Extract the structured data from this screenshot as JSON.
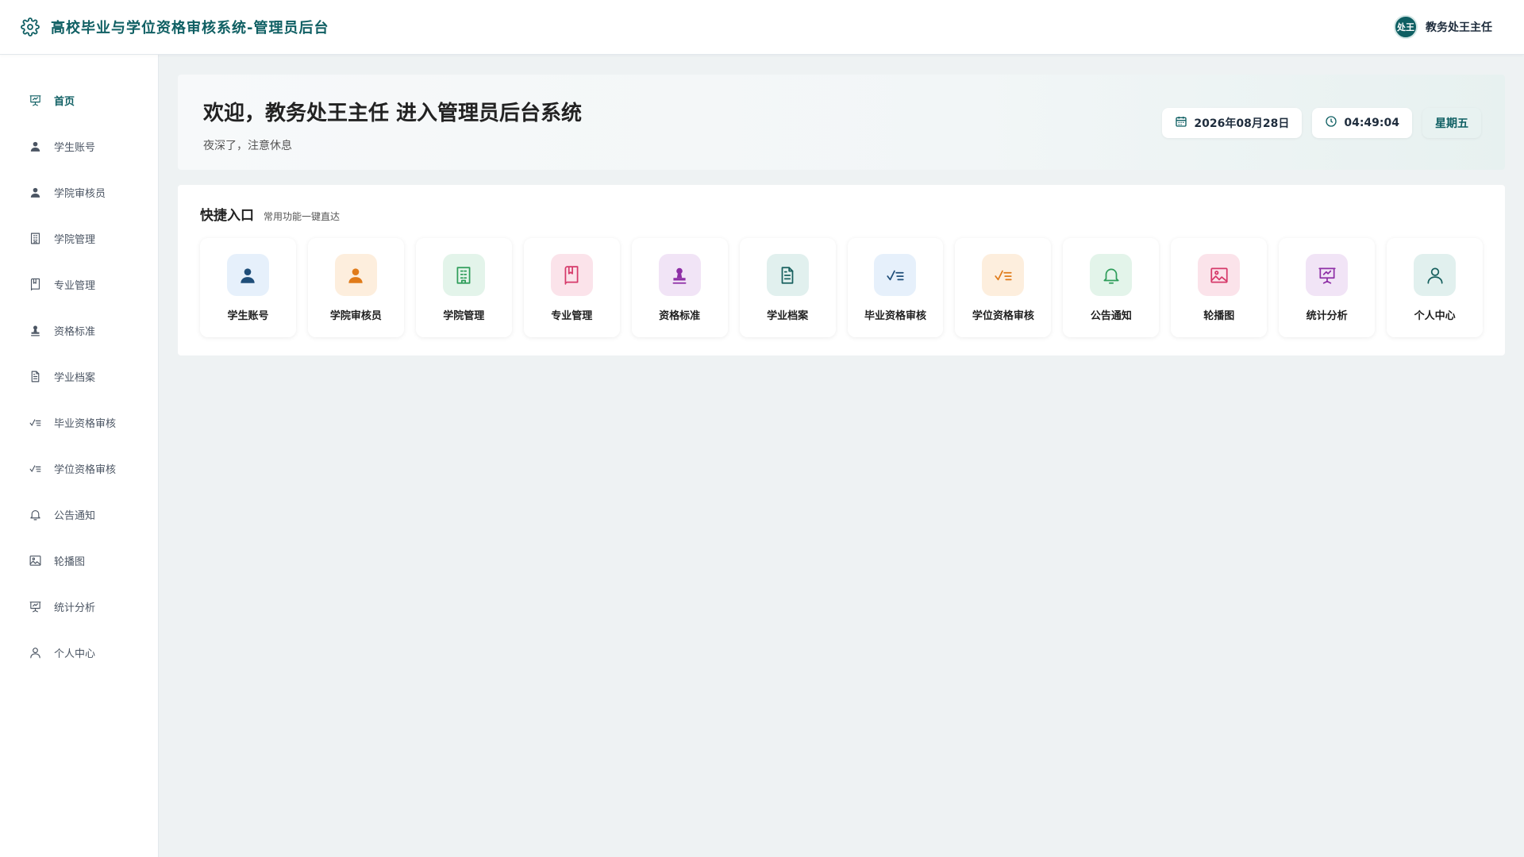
{
  "header": {
    "title": "高校毕业与学位资格审核系统-管理员后台",
    "user_avatar_text": "处王",
    "user_name": "教务处王主任",
    "accent": "#0f5f63"
  },
  "sidebar": {
    "items": [
      {
        "label": "首页",
        "icon": "dashboard-icon",
        "active": true
      },
      {
        "label": "学生账号",
        "icon": "user-icon"
      },
      {
        "label": "学院审核员",
        "icon": "user-icon"
      },
      {
        "label": "学院管理",
        "icon": "building-icon"
      },
      {
        "label": "专业管理",
        "icon": "book-icon"
      },
      {
        "label": "资格标准",
        "icon": "stamp-icon"
      },
      {
        "label": "学业档案",
        "icon": "document-icon"
      },
      {
        "label": "毕业资格审核",
        "icon": "check-list-icon"
      },
      {
        "label": "学位资格审核",
        "icon": "check-list-icon"
      },
      {
        "label": "公告通知",
        "icon": "bell-icon"
      },
      {
        "label": "轮播图",
        "icon": "image-icon"
      },
      {
        "label": "统计分析",
        "icon": "presentation-icon"
      },
      {
        "label": "个人中心",
        "icon": "profile-icon"
      }
    ]
  },
  "welcome": {
    "title": "欢迎，教务处王主任 进入管理员后台系统",
    "subtitle": "夜深了，注意休息",
    "date": "2026年08月28日",
    "time": "04:49:04",
    "weekday": "星期五"
  },
  "quick": {
    "title": "快捷入口",
    "subtitle": "常用功能一键直达",
    "tiles": [
      {
        "label": "学生账号",
        "icon": "user-icon",
        "bg": "#e6f0fb",
        "fg": "#1f4e79"
      },
      {
        "label": "学院审核员",
        "icon": "user-icon",
        "bg": "#fdeedd",
        "fg": "#e07b1a"
      },
      {
        "label": "学院管理",
        "icon": "building-icon",
        "bg": "#e3f4ea",
        "fg": "#2e9d5a"
      },
      {
        "label": "专业管理",
        "icon": "book-icon",
        "bg": "#fbe3ea",
        "fg": "#d63a6a"
      },
      {
        "label": "资格标准",
        "icon": "stamp-icon",
        "bg": "#f1e4f6",
        "fg": "#8e2fa6"
      },
      {
        "label": "学业档案",
        "icon": "document-icon",
        "bg": "#e1f0ee",
        "fg": "#17605e"
      },
      {
        "label": "毕业资格审核",
        "icon": "check-list-icon",
        "bg": "#e6f0fb",
        "fg": "#1f4e79"
      },
      {
        "label": "学位资格审核",
        "icon": "check-list-icon",
        "bg": "#fdeedd",
        "fg": "#e07b1a"
      },
      {
        "label": "公告通知",
        "icon": "bell-icon",
        "bg": "#e3f4ea",
        "fg": "#2e9d5a"
      },
      {
        "label": "轮播图",
        "icon": "image-icon",
        "bg": "#fbe3ea",
        "fg": "#d63a6a"
      },
      {
        "label": "统计分析",
        "icon": "presentation-icon",
        "bg": "#f1e4f6",
        "fg": "#8e2fa6"
      },
      {
        "label": "个人中心",
        "icon": "profile-icon",
        "bg": "#e1f0ee",
        "fg": "#17605e"
      }
    ]
  }
}
